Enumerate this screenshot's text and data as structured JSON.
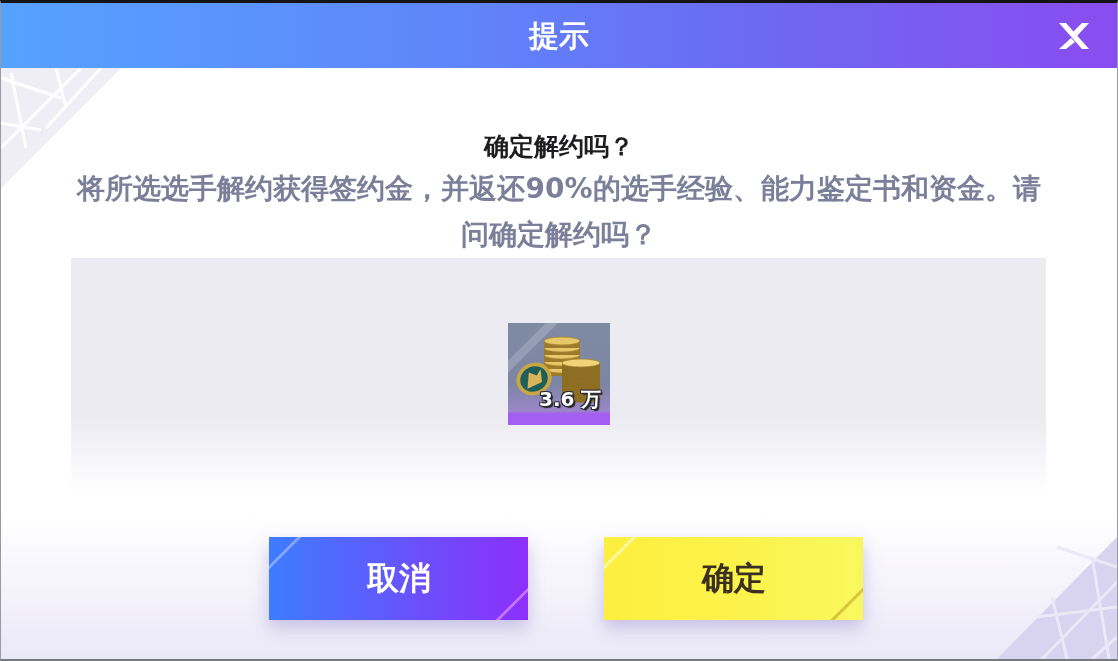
{
  "dialog": {
    "title": "提示"
  },
  "message": {
    "heading": "确定解约吗？",
    "text": "将所选选手解约获得签约金，并返还**90%**的选手经验、能力鉴定书和资金。请问确定解约吗？"
  },
  "rewards": [
    {
      "quantity": "3.6 万"
    }
  ],
  "buttons": [
    {
      "label": "取消",
      "kind": "cancel"
    },
    {
      "label": "确定",
      "kind": "confirm"
    }
  ]
}
